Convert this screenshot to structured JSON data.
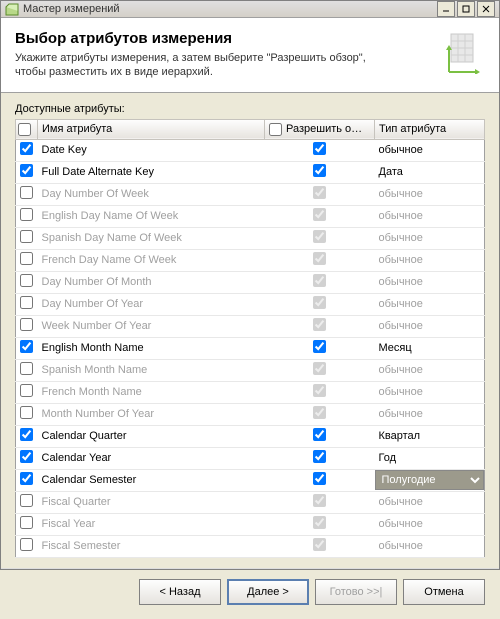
{
  "titlebar": {
    "title": "Мастер измерений"
  },
  "header": {
    "title": "Выбор атрибутов измерения",
    "subtitle": "Укажите атрибуты измерения, а затем выберите \"Разрешить обзор\", чтобы разместить их в виде иерархий."
  },
  "labels": {
    "available": "Доступные атрибуты:"
  },
  "columns": {
    "name": "Имя атрибута",
    "browse": "Разрешить о…",
    "type": "Тип атрибута"
  },
  "type_default": "обычное",
  "type_options": [
    "Полугодие"
  ],
  "rows": [
    {
      "checked": true,
      "name": "Date Key",
      "browse": true,
      "type": "обычное",
      "dropdown": false
    },
    {
      "checked": true,
      "name": "Full Date Alternate Key",
      "browse": true,
      "type": "Дата",
      "dropdown": false
    },
    {
      "checked": false,
      "name": "Day Number Of Week",
      "browse": true,
      "type": "обычное",
      "dropdown": false
    },
    {
      "checked": false,
      "name": "English Day Name Of Week",
      "browse": true,
      "type": "обычное",
      "dropdown": false
    },
    {
      "checked": false,
      "name": "Spanish Day Name Of Week",
      "browse": true,
      "type": "обычное",
      "dropdown": false
    },
    {
      "checked": false,
      "name": "French Day Name Of Week",
      "browse": true,
      "type": "обычное",
      "dropdown": false
    },
    {
      "checked": false,
      "name": "Day Number Of Month",
      "browse": true,
      "type": "обычное",
      "dropdown": false
    },
    {
      "checked": false,
      "name": "Day Number Of Year",
      "browse": true,
      "type": "обычное",
      "dropdown": false
    },
    {
      "checked": false,
      "name": "Week Number Of Year",
      "browse": true,
      "type": "обычное",
      "dropdown": false
    },
    {
      "checked": true,
      "name": "English Month Name",
      "browse": true,
      "type": "Месяц",
      "dropdown": false
    },
    {
      "checked": false,
      "name": "Spanish Month Name",
      "browse": true,
      "type": "обычное",
      "dropdown": false
    },
    {
      "checked": false,
      "name": "French Month Name",
      "browse": true,
      "type": "обычное",
      "dropdown": false
    },
    {
      "checked": false,
      "name": "Month Number Of Year",
      "browse": true,
      "type": "обычное",
      "dropdown": false
    },
    {
      "checked": true,
      "name": "Calendar Quarter",
      "browse": true,
      "type": "Квартал",
      "dropdown": false
    },
    {
      "checked": true,
      "name": "Calendar Year",
      "browse": true,
      "type": "Год",
      "dropdown": false
    },
    {
      "checked": true,
      "name": "Calendar Semester",
      "browse": true,
      "type": "Полугодие",
      "dropdown": true
    },
    {
      "checked": false,
      "name": "Fiscal Quarter",
      "browse": true,
      "type": "обычное",
      "dropdown": false
    },
    {
      "checked": false,
      "name": "Fiscal Year",
      "browse": true,
      "type": "обычное",
      "dropdown": false
    },
    {
      "checked": false,
      "name": "Fiscal Semester",
      "browse": true,
      "type": "обычное",
      "dropdown": false
    }
  ],
  "buttons": {
    "back": "< Назад",
    "next": "Далее >",
    "finish": "Готово >>|",
    "cancel": "Отмена"
  }
}
